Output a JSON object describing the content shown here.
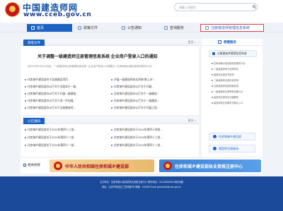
{
  "header": {
    "site_title": "中国建造师网",
    "site_url": "www.cceb.gov.cn",
    "search_placeholder": "请输入关键字"
  },
  "nav": {
    "items": [
      {
        "label": "首页",
        "icon": "home-icon"
      },
      {
        "label": "政策文件",
        "icon": "document-icon"
      },
      {
        "label": "公告通知",
        "icon": "announcement-icon"
      },
      {
        "label": "查询服务",
        "icon": "query-icon"
      },
      {
        "label": "注册建造师管理信息系统",
        "icon": "system-icon"
      }
    ],
    "active_index": 0,
    "highlighted_index": 4
  },
  "policy": {
    "heading": "政策文件",
    "more": "更多 >",
    "notice_title": "关于调整一级建造师注册管理信息系统 企业用户登录入口的通知",
    "notice_body": "自2024年10月14日起，“一级建造师注册管理信息系统” 企业用户登录入口调整为 “住房和城乡建设部政务服务平台” ..."
  },
  "policy_list_left": [
    "住房城乡建设部关于实施建设项目...",
    "住房城乡建设部办公厅关于全面实行一级...",
    "住房城乡建设部办公厅关于开展一级建造...",
    "住房城乡建设部办公厅关于进一步加强...",
    "住房城乡建设部办公厅关于注册建造师..."
  ],
  "policy_list_right": [
    "开展一级建造师执业资格“掌上办”...",
    "住房城乡建设部办公厅关于开展...",
    "住房城乡建设部办公厅关于一级建造...",
    "住房城乡建设部办公厅关于一级建造...",
    "住房城乡建设部办公厅关于开展工程..."
  ],
  "announcement": {
    "heading": "公告通知",
    "more": "更多 >",
    "left": [
      "住房城乡建设部关于2024年第四十三批...",
      "住房城乡建设部关于2024年第四十二批...",
      "住房城乡建设部关于2024年第四十一批..."
    ],
    "right": [
      "住房城乡建设部关于2024年第四十四批...",
      "住房城乡建设部关于2024年第四十三批...",
      "住房城乡建设部关于2024年第四十二批..."
    ]
  },
  "sidebar": {
    "heading": "便捷服务",
    "main_item": "注册建造师管理信息系统",
    "links": [
      "住房和城乡建设部政务服务平台",
      "一级建造师电子证照申请",
      "建造师注册证书查询",
      "二级建造师注册信息查询",
      "注册建造师信用档案查询",
      "一级建造师注册审批结果公示",
      "建造师注册常见问题解答",
      "建造师执业资格考试报名入口"
    ],
    "buttons": [
      {
        "label": "住房和城乡建设部",
        "icon": "ministry-icon"
      },
      {
        "label": "建造师注册查询",
        "icon": "search-icon"
      }
    ]
  },
  "related": {
    "label": "相关链接",
    "banner_a": "中华人民共和国住房和城乡建设部",
    "banner_b": "住房和城乡建设部执业资格注册中心"
  },
  "footer": {
    "line1": "主办单位：住房和城乡建设部执业资格注册中心  联系电话：010-58934000  网站地图",
    "line2": "地址：北京市海淀区三里河路9号  邮编：100835  Email: jianzaoshi@cceb.gov.cn"
  },
  "colors": {
    "brand_blue": "#1d63c4",
    "footer_blue": "#1b4a9b",
    "highlight_border": "#d9454b"
  }
}
